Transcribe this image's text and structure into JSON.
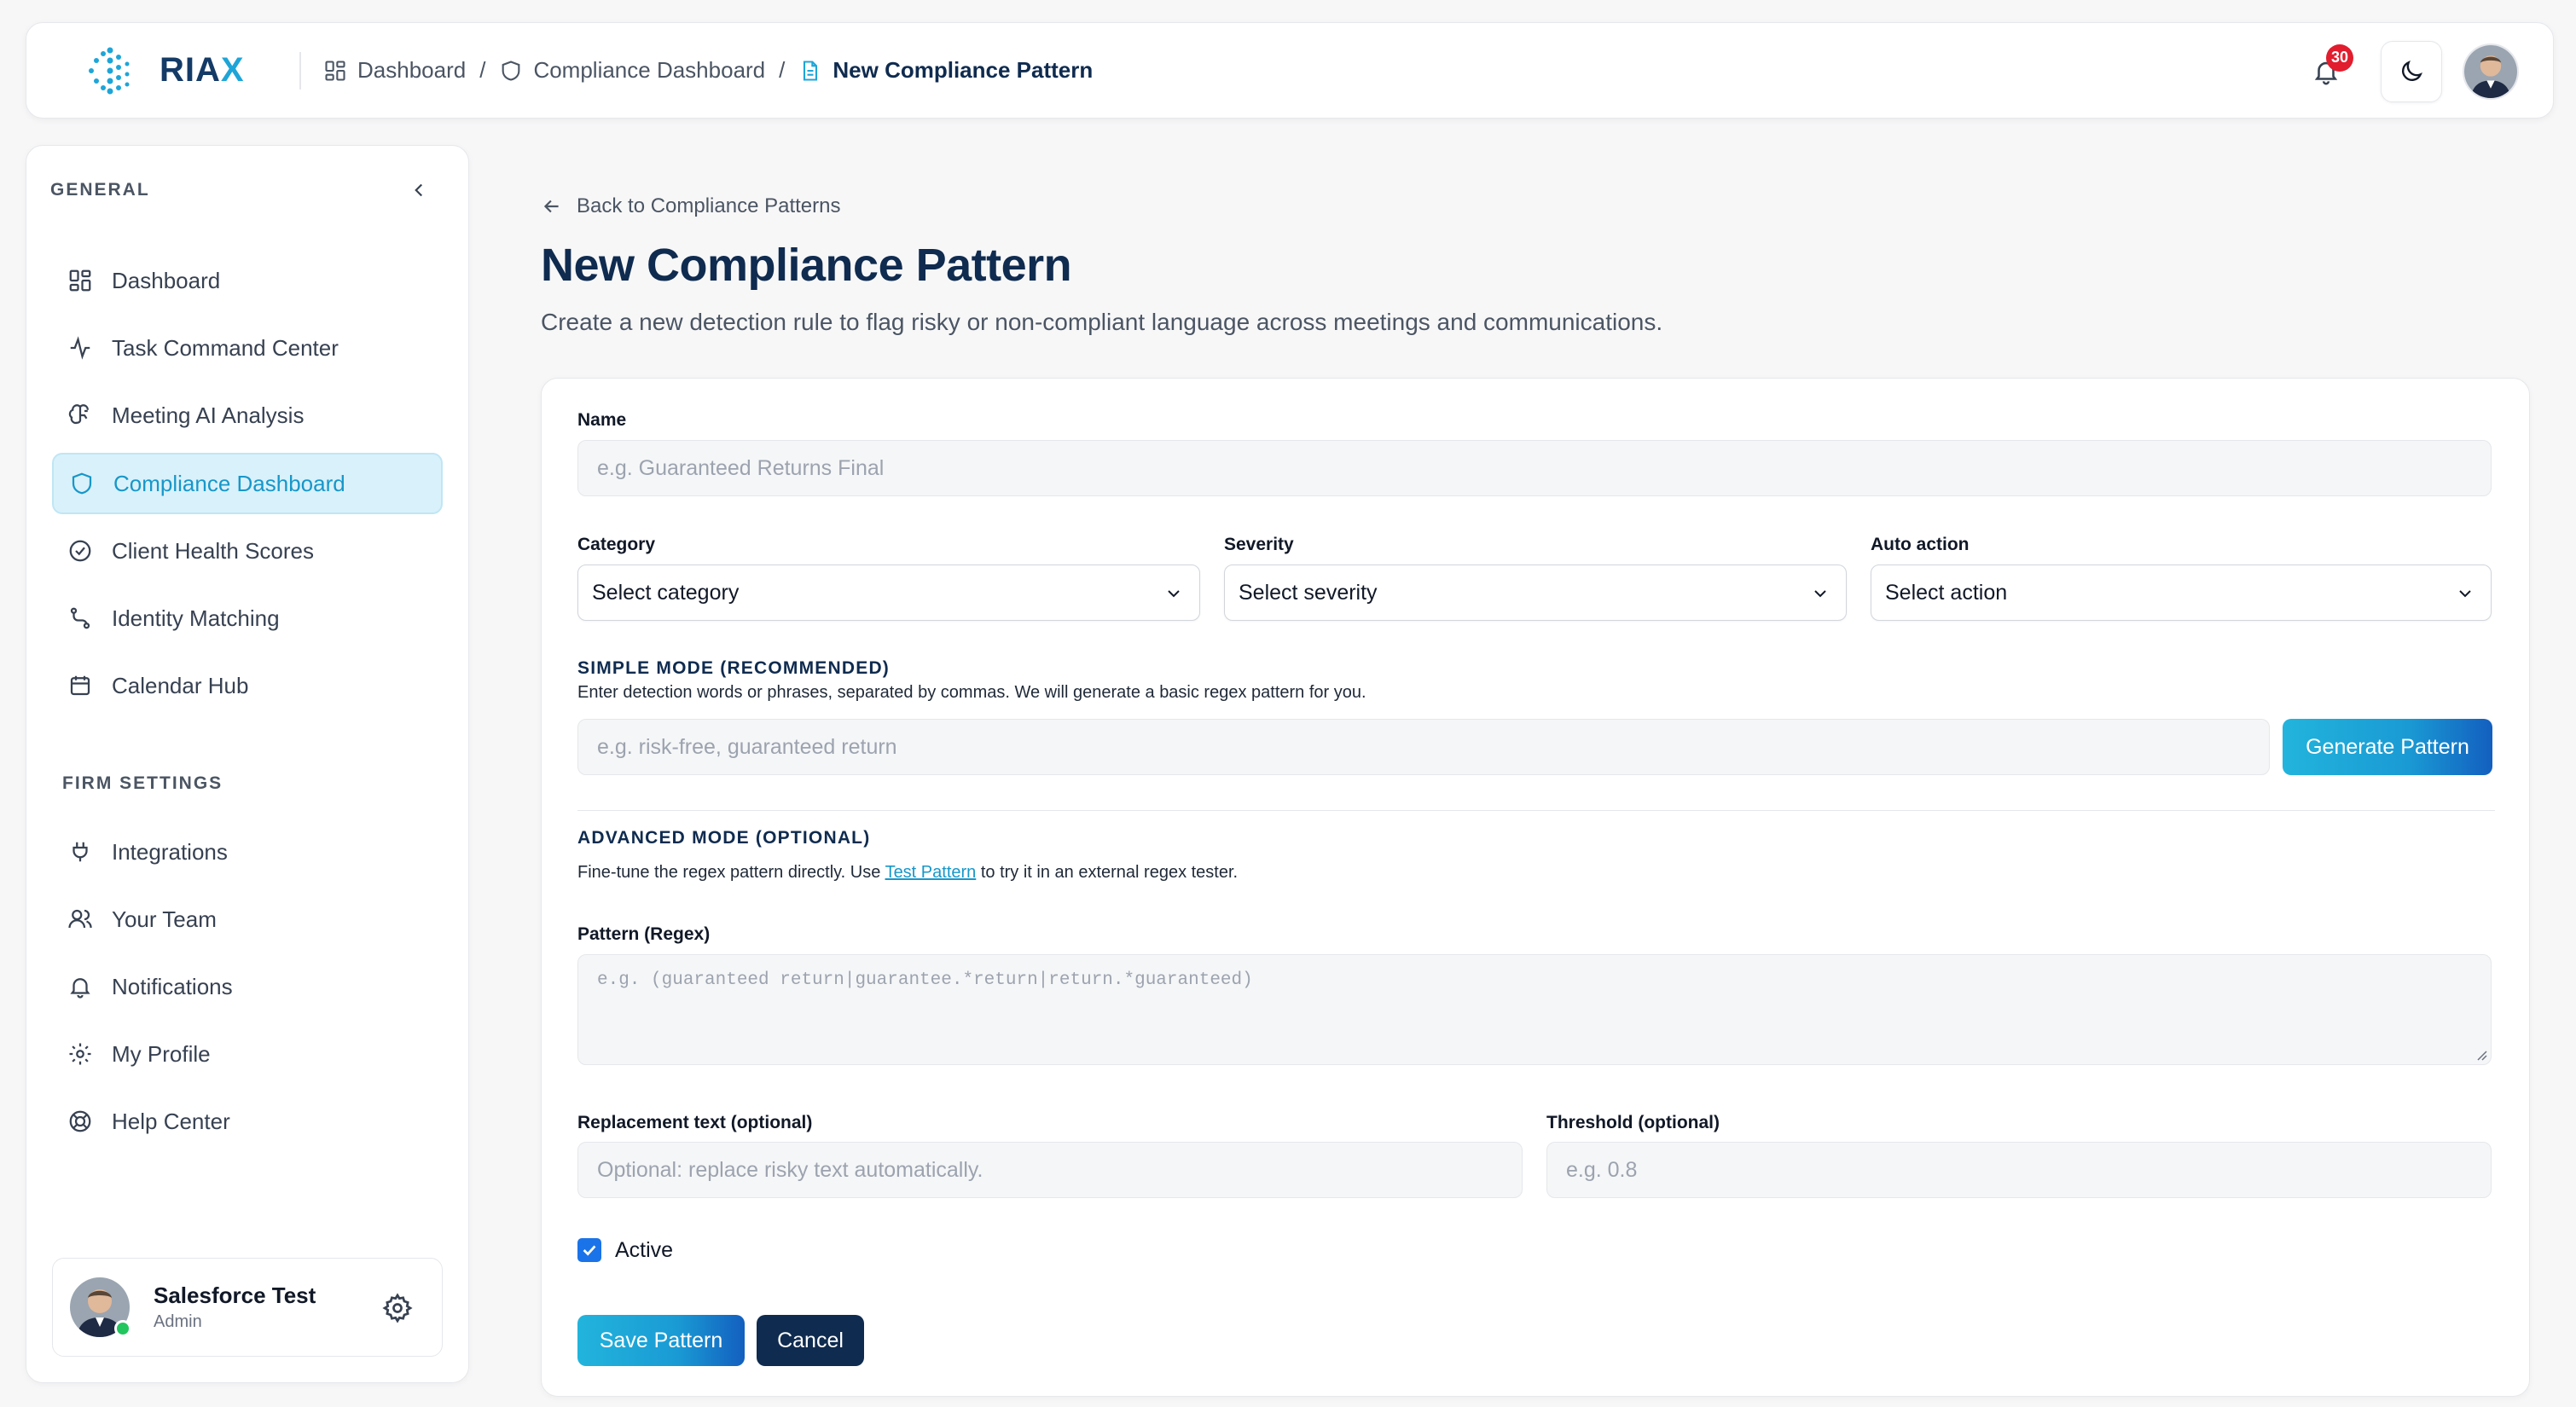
{
  "brand": {
    "name_main": "RIA",
    "name_accent": "X"
  },
  "breadcrumb": [
    {
      "label": "Dashboard",
      "icon": "grid-icon"
    },
    {
      "label": "Compliance Dashboard",
      "icon": "shield-icon"
    },
    {
      "label": "New Compliance Pattern",
      "icon": "document-icon"
    }
  ],
  "header": {
    "notification_count": "30"
  },
  "sidebar": {
    "general_title": "GENERAL",
    "general_items": [
      {
        "label": "Dashboard",
        "icon": "grid-icon"
      },
      {
        "label": "Task Command Center",
        "icon": "activity-icon"
      },
      {
        "label": "Meeting AI Analysis",
        "icon": "brain-icon"
      },
      {
        "label": "Compliance Dashboard",
        "icon": "shield-icon",
        "active": true
      },
      {
        "label": "Client Health Scores",
        "icon": "check-circle-icon"
      },
      {
        "label": "Identity Matching",
        "icon": "route-icon"
      },
      {
        "label": "Calendar Hub",
        "icon": "calendar-icon"
      }
    ],
    "firm_title": "FIRM SETTINGS",
    "firm_items": [
      {
        "label": "Integrations",
        "icon": "plug-icon"
      },
      {
        "label": "Your Team",
        "icon": "users-icon"
      },
      {
        "label": "Notifications",
        "icon": "bell-icon"
      },
      {
        "label": "My Profile",
        "icon": "gear-icon"
      },
      {
        "label": "Help Center",
        "icon": "lifebuoy-icon"
      }
    ],
    "user": {
      "name": "Salesforce Test",
      "role": "Admin"
    }
  },
  "page": {
    "back_label": "Back to Compliance Patterns",
    "title": "New Compliance Pattern",
    "subtitle": "Create a new detection rule to flag risky or non-compliant language across meetings and communications."
  },
  "form": {
    "name_label": "Name",
    "name_placeholder": "e.g. Guaranteed Returns Final",
    "category_label": "Category",
    "category_value": "Select category",
    "severity_label": "Severity",
    "severity_value": "Select severity",
    "action_label": "Auto action",
    "action_value": "Select action",
    "simple_title": "SIMPLE MODE (RECOMMENDED)",
    "simple_desc": "Enter detection words or phrases, separated by commas. We will generate a basic regex pattern for you.",
    "simple_placeholder": "e.g. risk-free, guaranteed return",
    "generate_label": "Generate Pattern",
    "advanced_title": "ADVANCED MODE (OPTIONAL)",
    "advanced_desc_pre": "Fine-tune the regex pattern directly. Use ",
    "advanced_desc_link": "Test Pattern",
    "advanced_desc_post": " to try it in an external regex tester.",
    "regex_label": "Pattern (Regex)",
    "regex_placeholder": "e.g. (guaranteed return|guarantee.*return|return.*guaranteed)",
    "replacement_label": "Replacement text (optional)",
    "replacement_placeholder": "Optional: replace risky text automatically.",
    "threshold_label": "Threshold (optional)",
    "threshold_placeholder": "e.g. 0.8",
    "active_label": "Active",
    "active_checked": true,
    "save_label": "Save Pattern",
    "cancel_label": "Cancel"
  }
}
